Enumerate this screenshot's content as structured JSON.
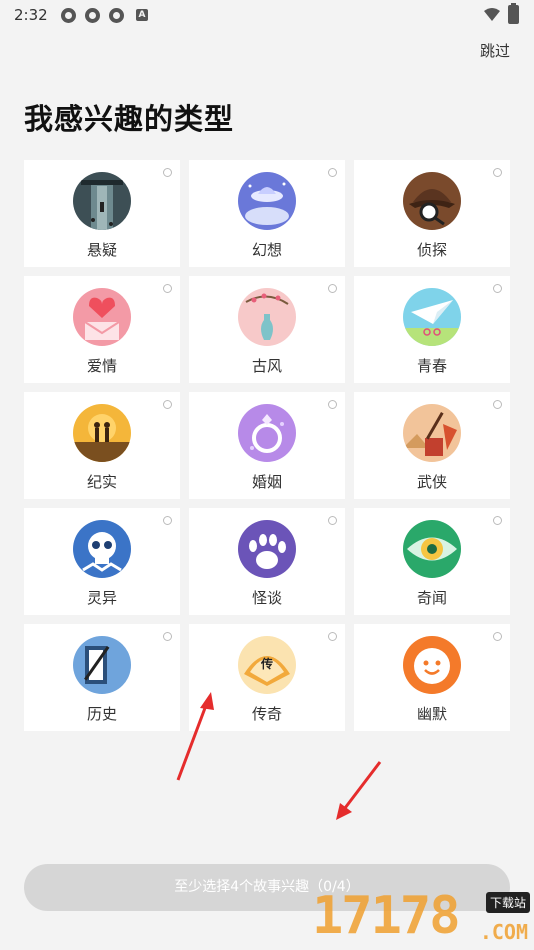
{
  "status_bar": {
    "time": "2:32",
    "notif_letter": "A"
  },
  "header": {
    "skip_label": "跳过",
    "title": "我感兴趣的类型"
  },
  "genres": [
    {
      "label": "悬疑",
      "icon": "corridor-icon"
    },
    {
      "label": "幻想",
      "icon": "ufo-icon"
    },
    {
      "label": "侦探",
      "icon": "detective-hat-icon"
    },
    {
      "label": "爱情",
      "icon": "heart-letter-icon"
    },
    {
      "label": "古风",
      "icon": "vase-icon"
    },
    {
      "label": "青春",
      "icon": "paper-plane-icon"
    },
    {
      "label": "纪实",
      "icon": "hikers-icon"
    },
    {
      "label": "婚姻",
      "icon": "ring-icon"
    },
    {
      "label": "武侠",
      "icon": "swordsman-icon"
    },
    {
      "label": "灵异",
      "icon": "skull-icon"
    },
    {
      "label": "怪谈",
      "icon": "claw-icon"
    },
    {
      "label": "奇闻",
      "icon": "eye-icon"
    },
    {
      "label": "历史",
      "icon": "book-brush-icon"
    },
    {
      "label": "传奇",
      "icon": "fan-icon",
      "badge": "传"
    },
    {
      "label": "幽默",
      "icon": "smile-icon"
    }
  ],
  "cta": {
    "label": "至少选择4个故事兴趣（0/4）"
  },
  "watermark": {
    "digits": "17178",
    "tag": "下载站",
    "domain": ".COM"
  }
}
